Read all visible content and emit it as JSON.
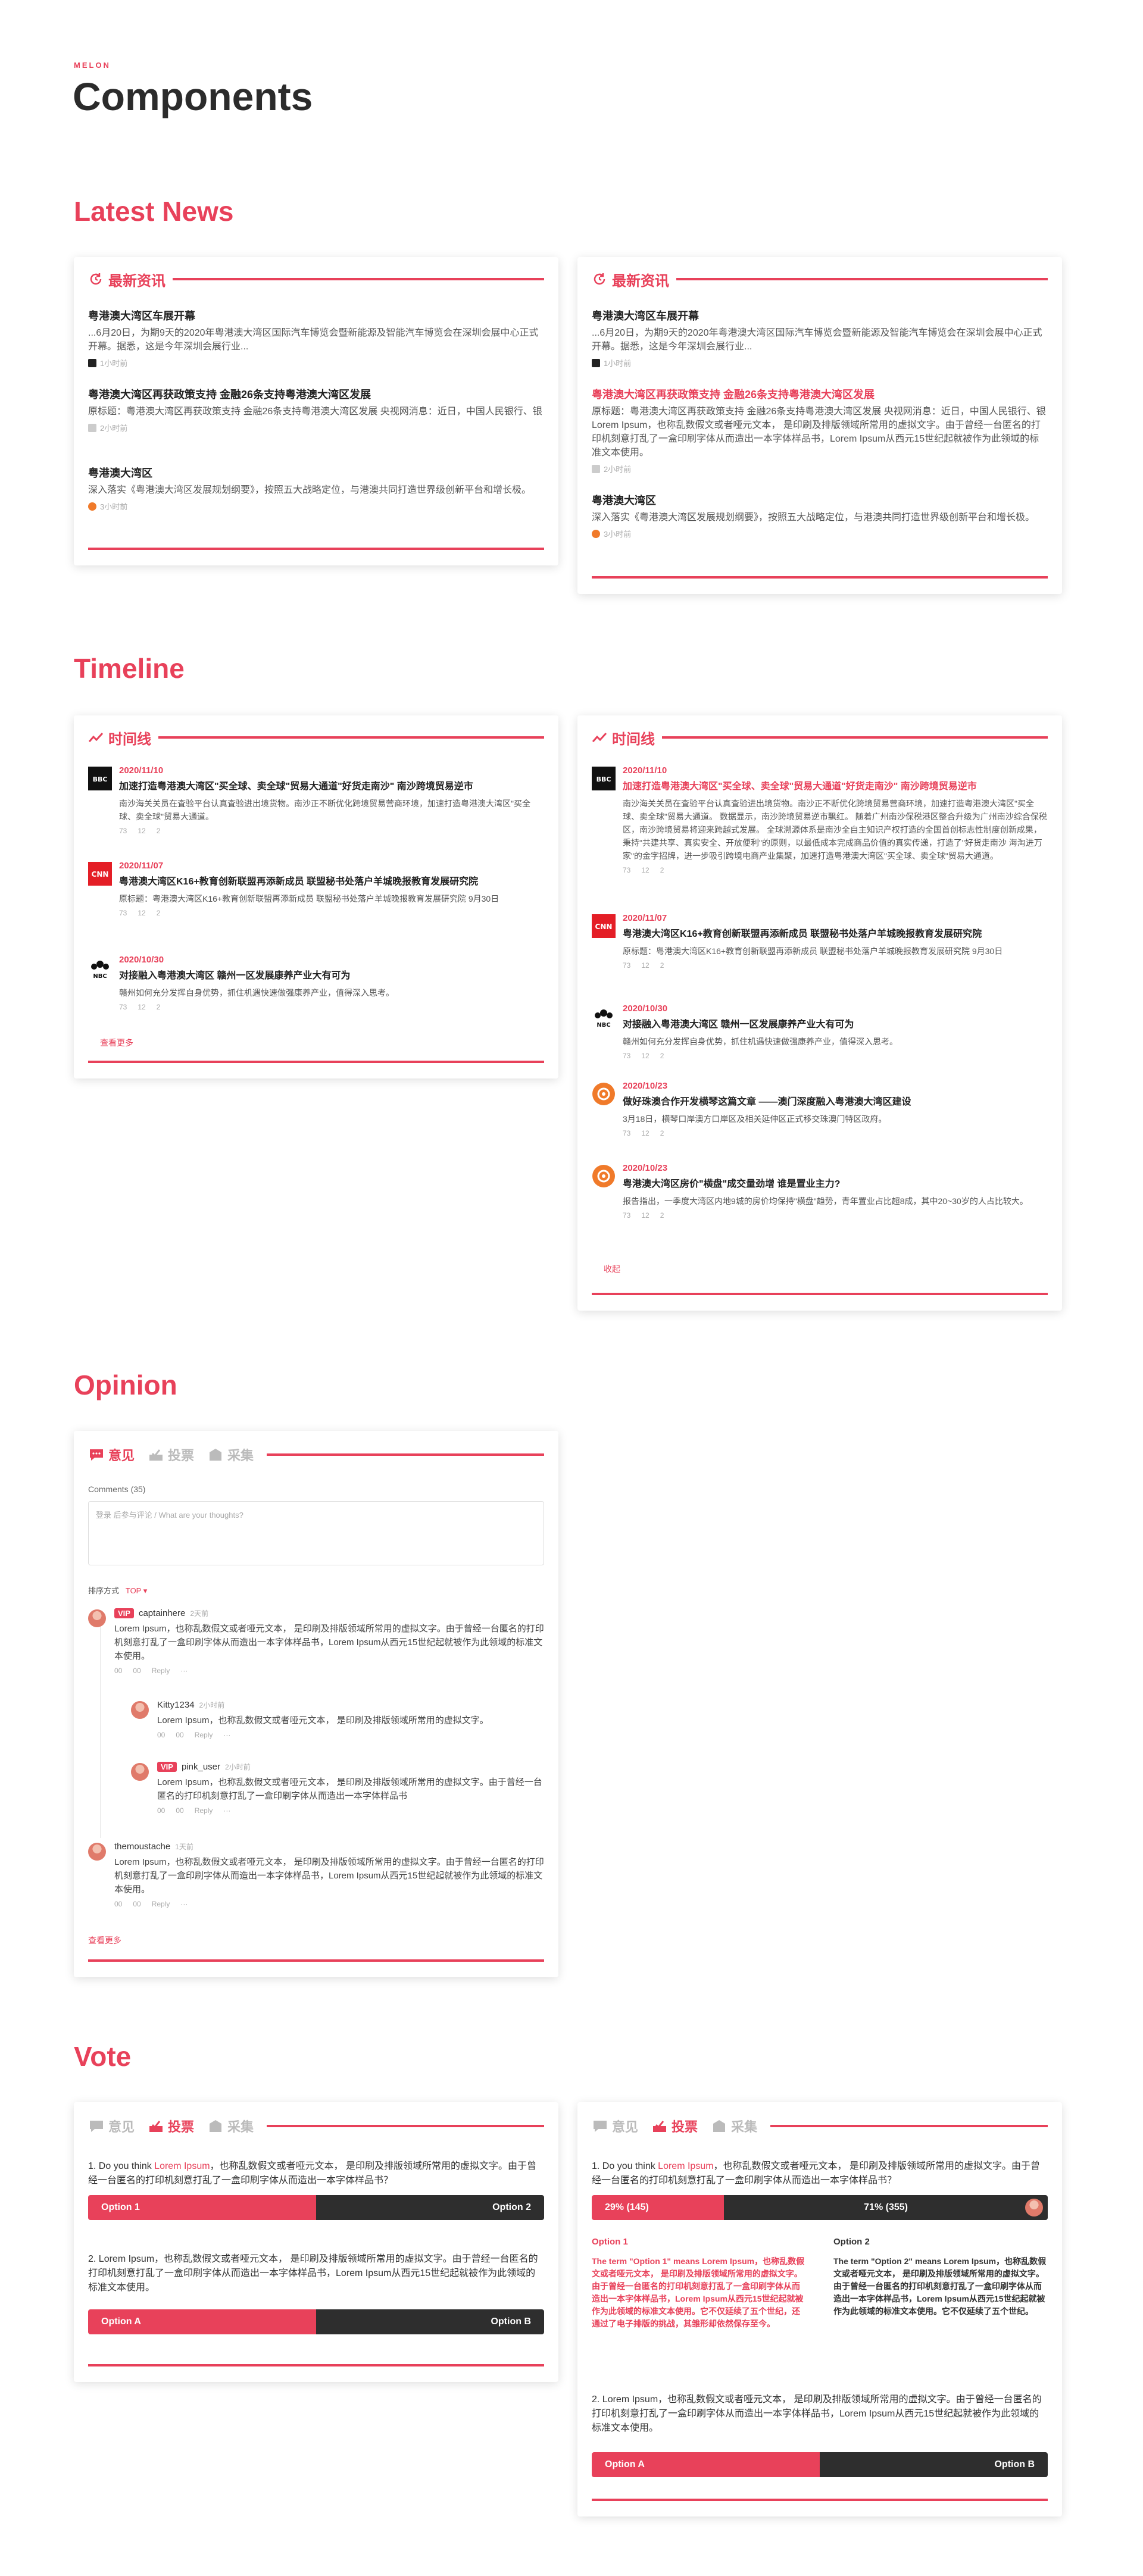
{
  "brand": "MELON",
  "page_title": "Components",
  "sections": {
    "news": "Latest News",
    "timeline": "Timeline",
    "opinion": "Opinion",
    "vote": "Vote"
  },
  "news": {
    "header": "最新资讯",
    "cards": [
      {
        "items": [
          {
            "title": "粤港澳大湾区车展开幕",
            "desc": "...6月20日，为期9天的2020年粤港澳大湾区国际汽车博览会暨新能源及智能汽车博览会在深圳会展中心正式开幕。据悉，这是今年深圳会展行业...",
            "time": "1小时前"
          },
          {
            "title": "粤港澳大湾区再获政策支持 金融26条支持粤港澳大湾区发展",
            "desc": "原标题：粤港澳大湾区再获政策支持 金融26条支持粤港澳大湾区发展 央视网消息：近日，中国人民银行、银",
            "time": "2小时前"
          },
          {
            "title": "粤港澳大湾区",
            "desc": "深入落实《粤港澳大湾区发展规划纲要》，按照五大战略定位，与港澳共同打造世界级创新平台和增长极。",
            "time": "3小时前"
          }
        ]
      },
      {
        "items": [
          {
            "title": "粤港澳大湾区车展开幕",
            "desc": "...6月20日，为期9天的2020年粤港澳大湾区国际汽车博览会暨新能源及智能汽车博览会在深圳会展中心正式开幕。据悉，这是今年深圳会展行业...",
            "time": "1小时前"
          },
          {
            "title": "粤港澳大湾区再获政策支持 金融26条支持粤港澳大湾区发展",
            "desc": "原标题：粤港澳大湾区再获政策支持 金融26条支持粤港澳大湾区发展 央视网消息：近日，中国人民银行、银 Lorem Ipsum，也称乱数假文或者哑元文本， 是印刷及排版领域所常用的虚拟文字。由于曾经一台匿名的打印机刻意打乱了一盒印刷字体从而造出一本字体样品书，Lorem Ipsum从西元15世纪起就被作为此领域的标准文本使用。",
            "time": "2小时前"
          },
          {
            "title": "粤港澳大湾区",
            "desc": "深入落实《粤港澳大湾区发展规划纲要》，按照五大战略定位，与港澳共同打造世界级创新平台和增长极。",
            "time": "3小时前"
          }
        ]
      }
    ]
  },
  "timeline": {
    "header": "时间线",
    "more": "查看更多",
    "collapse": "收起",
    "items": [
      {
        "source": "BBC",
        "date": "2020/11/10",
        "title": "加速打造粤港澳大湾区\"买全球、卖全球\"贸易大通道\"好货走南沙\" 南沙跨境贸易逆市",
        "desc": "南沙海关关员在査验平台认真査验进出境货物。南沙正不断优化跨境贸易营商环境，加速打造粤港澳大湾区\"买全球、卖全球\"贸易大通道。",
        "likes": "73",
        "comments": "12",
        "shares": "2"
      },
      {
        "source": "CNN",
        "date": "2020/11/07",
        "title": "粤港澳大湾区K16+教育创新联盟再添新成员 联盟秘书处落户羊城晚报教育发展研究院",
        "desc": "原标题：粤港澳大湾区K16+教育创新联盟再添新成员 联盟秘书处落户羊城晚报教育发展研究院 9月30日",
        "likes": "73",
        "comments": "12",
        "shares": "2"
      },
      {
        "source": "NBC",
        "date": "2020/10/30",
        "title": "对接融入粤港澳大湾区 赣州一区发展康养产业大有可为",
        "desc": "赣州如何充分发挥自身优势，抓住机遇快速做强康养产业，值得深入思考。",
        "likes": "73",
        "comments": "12",
        "shares": "2"
      },
      {
        "source": "Weibo",
        "date": "2020/10/23",
        "title": "做好珠澳合作开发横琴这篇文章 ——澳门深度融入粤港澳大湾区建设",
        "desc": "3月18日，横琴口岸澳方口岸区及相关延伸区正式移交珠澳门特区政府。",
        "likes": "73",
        "comments": "12",
        "shares": "2"
      },
      {
        "source": "Weibo",
        "date": "2020/10/23",
        "title": "粤港澳大湾区房价\"横盘\"成交量劲增 谁是置业主力?",
        "desc": "报告指出，一季度大湾区内地9城的房价均保持\"横盘\"趋势，青年置业占比超8成，其中20~30岁的人占比较大。",
        "likes": "73",
        "comments": "12",
        "shares": "2"
      }
    ],
    "expanded_desc": "南沙海关关员在査验平台认真査验进出境货物。南沙正不断优化跨境贸易营商环境，加速打造粤港澳大湾区\"买全球、卖全球\"贸易大通道。 数据显示，南沙跨境贸易逆市飘红。 随着广州南沙保税港区整合升级为广州南沙综合保税区，南沙跨境贸易将迎来跨越式发展。 全球溯源体系是南沙全自主知识产权打造的全国首创标志性制度创新成果，秉持\"共建共享、真实安全、开放便利\"的原则，以最低成本完成商品价值的真实传递，打造了\"好货走南沙 海淘进万家\"的金字招牌，进一步吸引跨境电商产业集聚，加速打造粤港澳大湾区\"买全球、卖全球\"贸易大通道。"
  },
  "opinion": {
    "tabs": [
      "意见",
      "投票",
      "采集"
    ],
    "comments_label": "Comments (35)",
    "placeholder": "登录 后参与评论 / What are your thoughts?",
    "sort_label": "排序方式",
    "sort_value": "TOP",
    "comments": [
      {
        "vip": true,
        "user": "captainhere",
        "time": "2天前",
        "text": "Lorem Ipsum，也称乱数假文或者哑元文本， 是印刷及排版领域所常用的虚拟文字。由于曾经一台匿名的打印机刻意打乱了一盒印刷字体从而造出一本字体样品书，Lorem Ipsum从西元15世纪起就被作为此领域的标准文本使用。",
        "likes": "00",
        "dislikes": "00",
        "reply": "Reply"
      },
      {
        "vip": false,
        "user": "Kitty1234",
        "time": "2小时前",
        "text": "Lorem Ipsum，也称乱数假文或者哑元文本， 是印刷及排版领域所常用的虚拟文字。",
        "likes": "00",
        "dislikes": "00",
        "reply": "Reply"
      },
      {
        "vip": true,
        "user": "pink_user",
        "time": "2小时前",
        "text": "Lorem Ipsum，也称乱数假文或者哑元文本， 是印刷及排版领域所常用的虚拟文字。由于曾经一台匿名的打印机刻意打乱了一盒印刷字体从而造出一本字体样品书",
        "likes": "00",
        "dislikes": "00",
        "reply": "Reply"
      },
      {
        "vip": false,
        "user": "themoustache",
        "time": "1天前",
        "text": "Lorem Ipsum，也称乱数假文或者哑元文本， 是印刷及排版领域所常用的虚拟文字。由于曾经一台匿名的打印机刻意打乱了一盒印刷字体从而造出一本字体样品书，Lorem Ipsum从西元15世纪起就被作为此领域的标准文本使用。",
        "likes": "00",
        "dislikes": "00",
        "reply": "Reply"
      }
    ],
    "more": "查看更多"
  },
  "vote": {
    "q1_pre": "1. Do you think ",
    "q1_hl": "Lorem Ipsum",
    "q1_post": "，也称乱数假文或者哑元文本， 是印刷及排版领域所常用的虚拟文字。由于曾经一台匿名的打印机刻意打乱了一盒印刷字体从而造出一本字体样品书？",
    "q2": "2. Lorem Ipsum，也称乱数假文或者哑元文本， 是印刷及排版领域所常用的虚拟文字。由于曾经一台匿名的打印机刻意打乱了一盒印刷字体从而造出一本字体样品书，Lorem Ipsum从西元15世纪起就被作为此领域的标准文本使用。",
    "option1": "Option 1",
    "option2": "Option 2",
    "optionA": "Option A",
    "optionB": "Option B",
    "result1": "29% (145)",
    "result2": "71% (355)",
    "result1_share": 0.29,
    "opt1_title": "Option 1",
    "opt2_title": "Option 2",
    "opt1_text": "The term \"Option 1\" means Lorem Ipsum，也称乱数假文或者哑元文本， 是印刷及排版领域所常用的虚拟文字。由于曾经一台匿名的打印机刻意打乱了一盒印刷字体从而造出一本字体样品书，Lorem Ipsum从西元15世纪起就被作为此领域的标准文本使用。它不仅延续了五个世纪，还通过了电子排版的挑战，其雏形却依然保存至今。",
    "opt2_text": "The term \"Option 2\" means Lorem Ipsum，也称乱数假文或者哑元文本， 是印刷及排版领域所常用的虚拟文字。由于曾经一台匿名的打印机刻意打乱了一盒印刷字体从而造出一本字体样品书，Lorem Ipsum从西元15世纪起就被作为此领域的标准文本使用。它不仅延续了五个世纪。"
  }
}
